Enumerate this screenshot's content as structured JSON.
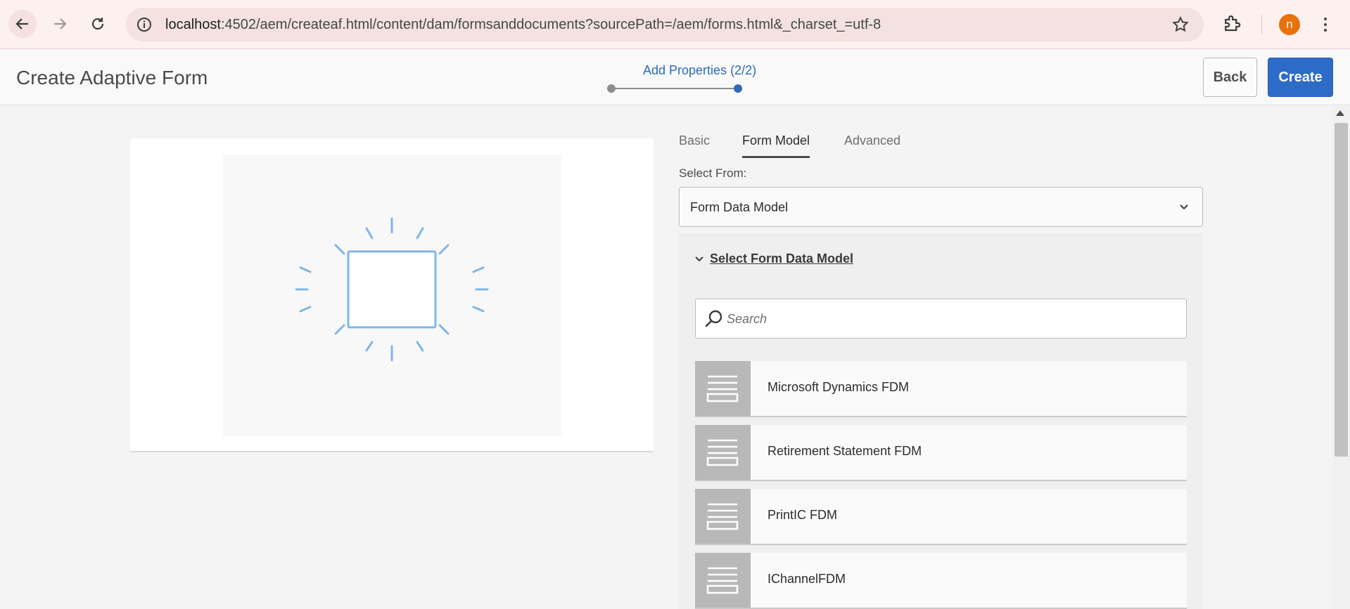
{
  "browser": {
    "url_host": "localhost",
    "url_rest": ":4502/aem/createaf.html/content/dam/formsanddocuments?sourcePath=/aem/forms.html&_charset_=utf-8",
    "avatar_letter": "n",
    "icons": [
      "back-arrow-icon",
      "forward-arrow-icon",
      "reload-icon",
      "site-info-icon",
      "bookmark-star-icon",
      "extensions-icon",
      "kebab-menu-icon"
    ]
  },
  "header": {
    "title": "Create Adaptive Form",
    "wizard_step": "Add Properties (2/2)",
    "back_label": "Back",
    "create_label": "Create",
    "accent": "#2d6bc8"
  },
  "tabs": [
    {
      "label": "Basic",
      "active": false
    },
    {
      "label": "Form Model",
      "active": true
    },
    {
      "label": "Advanced",
      "active": false
    }
  ],
  "select": {
    "label": "Select From:",
    "value": "Form Data Model"
  },
  "fdm": {
    "section_title": "Select Form Data Model",
    "search_placeholder": "Search",
    "items": [
      {
        "name": "Microsoft Dynamics FDM"
      },
      {
        "name": "Retirement Statement FDM"
      },
      {
        "name": "PrintIC FDM"
      },
      {
        "name": "IChannelFDM"
      }
    ]
  }
}
